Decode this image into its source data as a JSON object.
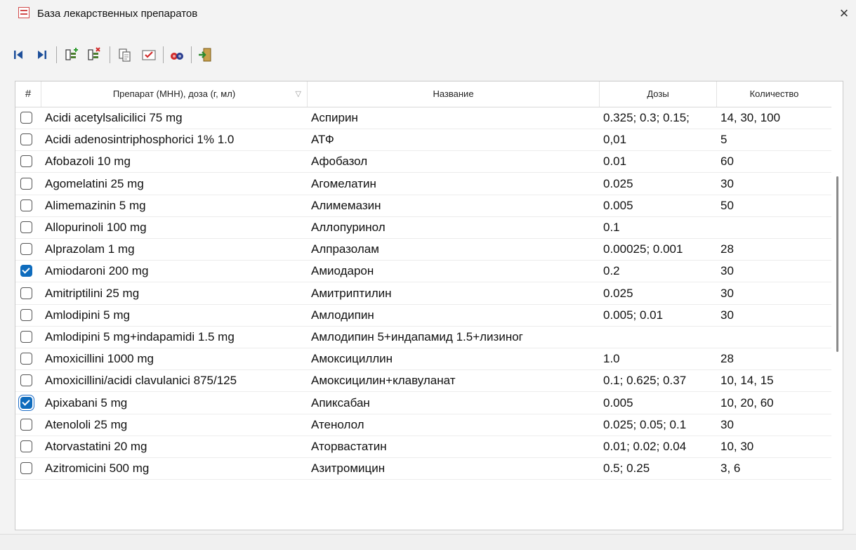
{
  "window": {
    "title": "База лекарственных препаратов",
    "close_icon": "×"
  },
  "toolbar": {
    "items": [
      {
        "name": "first-record-icon"
      },
      {
        "name": "last-record-icon"
      },
      {
        "name": "add-item-icon"
      },
      {
        "name": "delete-item-icon"
      },
      {
        "name": "copy-icon"
      },
      {
        "name": "edit-check-icon"
      },
      {
        "name": "search-icon"
      },
      {
        "name": "exit-icon"
      }
    ]
  },
  "table": {
    "headers": {
      "num": "#",
      "drug": "Препарат (МНН), доза (г, мл)",
      "name": "Название",
      "doses": "Дозы",
      "qty": "Количество"
    },
    "sort_indicator": "▽",
    "rows": [
      {
        "checked": false,
        "drug": "Acidi acetylsalicilici 75 mg",
        "name": "Аспирин",
        "doses": "0.325; 0.3; 0.15;",
        "qty": "14, 30, 100"
      },
      {
        "checked": false,
        "drug": "Acidi adenosintriphosphorici 1% 1.0",
        "name": "АТФ",
        "doses": "0,01",
        "qty": "5"
      },
      {
        "checked": false,
        "drug": "Afobazoli 10 mg",
        "name": "Афобазол",
        "doses": "0.01",
        "qty": "60"
      },
      {
        "checked": false,
        "drug": "Agomelatini 25 mg",
        "name": "Агомелатин",
        "doses": "0.025",
        "qty": "30"
      },
      {
        "checked": false,
        "drug": "Alimemazinin 5 mg",
        "name": "Алимемазин",
        "doses": "0.005",
        "qty": "50"
      },
      {
        "checked": false,
        "drug": "Allopurinoli 100 mg",
        "name": "Аллопуринол",
        "doses": "0.1",
        "qty": ""
      },
      {
        "checked": false,
        "drug": "Alprazolam 1 mg",
        "name": "Алпразолам",
        "doses": "0.00025; 0.001",
        "qty": "28"
      },
      {
        "checked": true,
        "drug": "Amiodaroni 200 mg",
        "name": "Амиодарон",
        "doses": "0.2",
        "qty": "30"
      },
      {
        "checked": false,
        "drug": "Amitriptilini 25 mg",
        "name": "Амитриптилин",
        "doses": "0.025",
        "qty": "30"
      },
      {
        "checked": false,
        "drug": "Amlodipini 5 mg",
        "name": "Амлодипин",
        "doses": "0.005; 0.01",
        "qty": "30"
      },
      {
        "checked": false,
        "drug": "Amlodipini 5 mg+indapamidi 1.5 mg",
        "name": "Амлодипин 5+индапамид 1.5+лизиног",
        "doses": "",
        "qty": ""
      },
      {
        "checked": false,
        "drug": "Amoxicillini 1000 mg",
        "name": "Амоксициллин",
        "doses": "1.0",
        "qty": "28"
      },
      {
        "checked": false,
        "drug": "Amoxicillini/acidi clavulanici 875/125",
        "name": "Амоксицилин+клавуланат",
        "doses": "0.1;  0.625; 0.37",
        "qty": "10, 14, 15"
      },
      {
        "checked": true,
        "focused": true,
        "drug": "Apixabani 5  mg",
        "name": "Апиксабан",
        "doses": "0.005",
        "qty": "10, 20, 60"
      },
      {
        "checked": false,
        "drug": "Atenololi 25 mg",
        "name": "Атенолол",
        "doses": "0.025; 0.05; 0.1",
        "qty": "30"
      },
      {
        "checked": false,
        "drug": "Atorvastatini 20 mg",
        "name": "Аторвастатин",
        "doses": "0.01; 0.02; 0.04",
        "qty": "10, 30"
      },
      {
        "checked": false,
        "drug": "Azitromicini 500 mg",
        "name": "Азитромицин",
        "doses": "0.5; 0.25",
        "qty": "3, 6"
      }
    ]
  },
  "colors": {
    "accent": "#0f6cbd",
    "grid_line": "#ececec"
  }
}
